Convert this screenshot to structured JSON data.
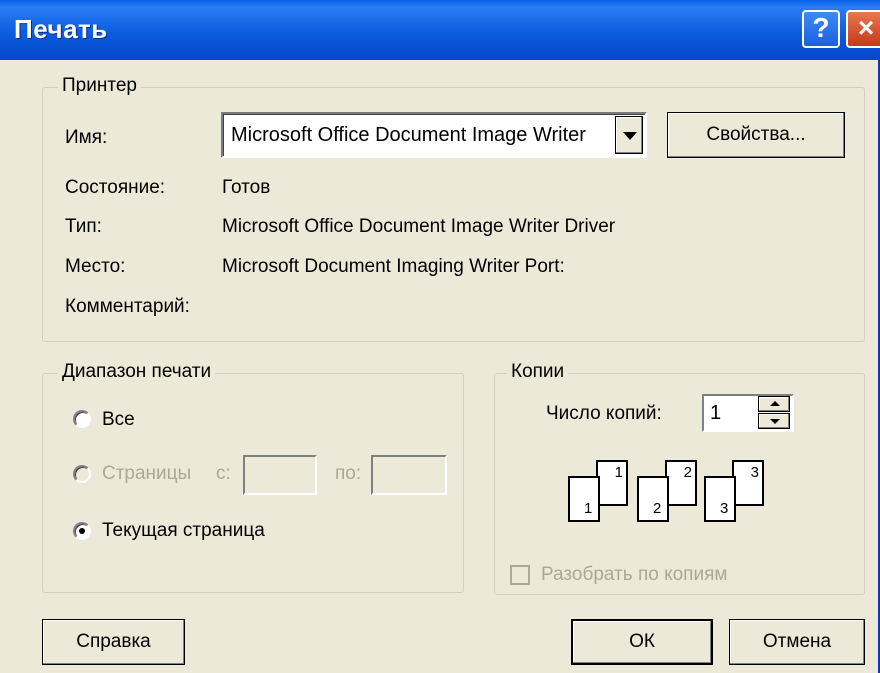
{
  "window": {
    "title": "Печать",
    "help_btn": "?",
    "close_btn": "×"
  },
  "printer": {
    "group_title": "Принтер",
    "name_label": "Имя:",
    "name_value": "Microsoft Office Document Image Writer",
    "properties_button": "Свойства...",
    "status_label": "Состояние:",
    "status_value": "Готов",
    "type_label": "Тип:",
    "type_value": "Microsoft Office Document Image Writer Driver",
    "where_label": "Место:",
    "where_value": "Microsoft Document Imaging Writer Port:",
    "comment_label": "Комментарий:",
    "comment_value": ""
  },
  "range": {
    "group_title": "Диапазон печати",
    "all_label": "Все",
    "pages_label": "Страницы",
    "from_label": "с:",
    "to_label": "по:",
    "from_value": "",
    "to_value": "",
    "current_label": "Текущая страница",
    "selected": "current"
  },
  "copies": {
    "group_title": "Копии",
    "count_label": "Число копий:",
    "count_value": "1",
    "collate_label": "Разобрать по копиям",
    "collate_checked": false,
    "collate_pages": [
      "1",
      "1",
      "2",
      "2",
      "3",
      "3"
    ]
  },
  "buttons": {
    "help": "Справка",
    "ok": "ОК",
    "cancel": "Отмена"
  }
}
